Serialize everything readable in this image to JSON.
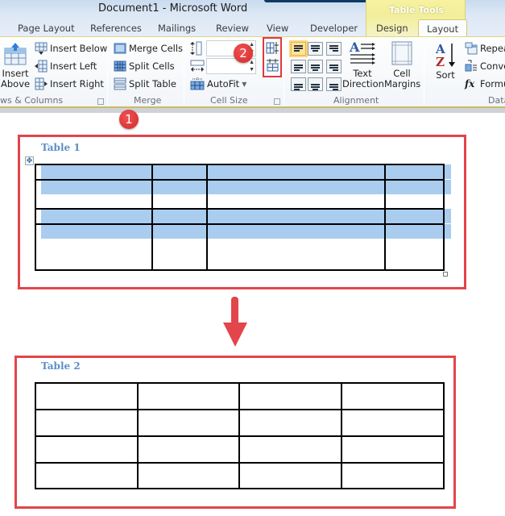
{
  "window": {
    "title": "Document1  -  Microsoft Word",
    "contextual_tab_group": "Table Tools"
  },
  "tabs": [
    {
      "label": "Page Layout",
      "active": false
    },
    {
      "label": "References",
      "active": false
    },
    {
      "label": "Mailings",
      "active": false
    },
    {
      "label": "Review",
      "active": false
    },
    {
      "label": "View",
      "active": false
    },
    {
      "label": "Developer",
      "active": false
    },
    {
      "label": "Design",
      "active": false
    },
    {
      "label": "Layout",
      "active": true
    }
  ],
  "ribbon": {
    "rows_columns": {
      "label": "ws & Columns",
      "insert_above": [
        "Insert",
        "Above"
      ],
      "insert_below": "Insert Below",
      "insert_left": "Insert Left",
      "insert_right": "Insert Right"
    },
    "merge": {
      "label": "Merge",
      "merge_cells": "Merge Cells",
      "split_cells": "Split Cells",
      "split_table": "Split Table"
    },
    "cell_size": {
      "label": "Cell Size",
      "height_value": "",
      "width_value": "",
      "autofit": "AutoFit",
      "distribute_rows_icon": "distribute-rows-icon",
      "distribute_columns_icon": "distribute-columns-icon"
    },
    "alignment": {
      "label": "Alignment",
      "text_direction": [
        "Text",
        "Direction"
      ],
      "cell_margins": [
        "Cell",
        "Margins"
      ]
    },
    "data": {
      "label": "Data",
      "sort": "Sort",
      "repeat": "Repea",
      "convert": "Conve",
      "formula": "Formu"
    }
  },
  "annotations": {
    "badge_1": "1",
    "badge_2": "2",
    "accent_color": "#e2454a"
  },
  "document": {
    "table1": {
      "caption": "Table 1",
      "rows": 5,
      "columns": 4,
      "selected_rows": [
        1,
        2,
        4,
        5
      ],
      "selection_color": "#a9ccef"
    },
    "table2": {
      "caption": "Table 2",
      "rows": 4,
      "columns": 4
    }
  }
}
